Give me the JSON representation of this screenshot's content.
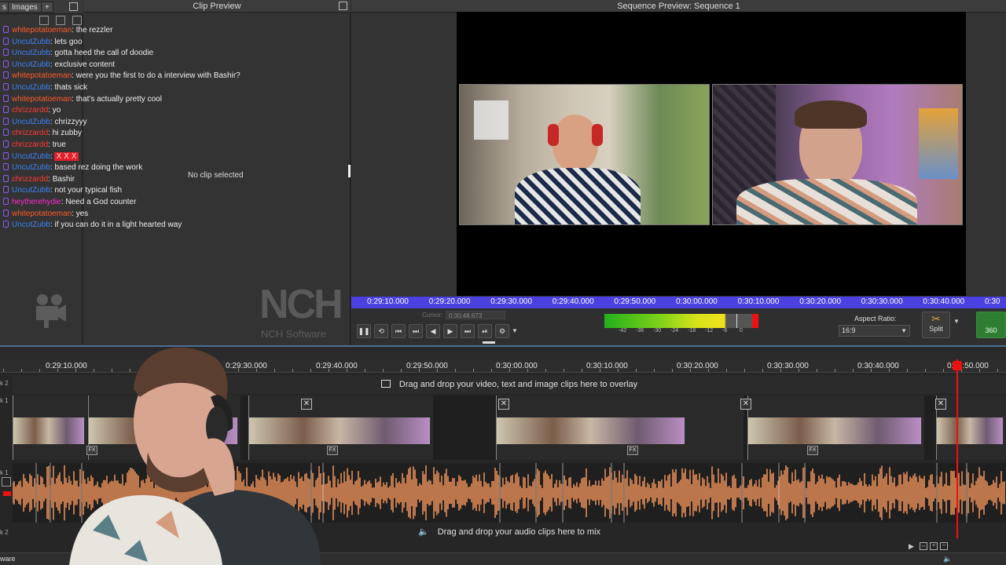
{
  "left_panel": {
    "tabs": [
      "s",
      "Images",
      "+"
    ],
    "clip_preview_title": "Clip Preview",
    "no_clip_text": "No clip selected",
    "logo_text": "NCH",
    "logo_sub": "NCH Software"
  },
  "chat": [
    {
      "user": "whitepotatoeman",
      "color": "orange",
      "msg": "the rezzler"
    },
    {
      "user": "UncutZubb",
      "color": "blue",
      "msg": "lets goo"
    },
    {
      "user": "UncutZubb",
      "color": "blue",
      "msg": "gotta heed the call of doodie"
    },
    {
      "user": "UncutZubb",
      "color": "blue",
      "msg": "exclusive content"
    },
    {
      "user": "whitepotatoeman",
      "color": "orange",
      "msg": "were you the first to do a interview with Bashir?"
    },
    {
      "user": "UncutZubb",
      "color": "blue",
      "msg": "thats sick"
    },
    {
      "user": "whitepotatoeman",
      "color": "orange",
      "msg": "that's actually pretty cool"
    },
    {
      "user": "chrizzardd",
      "color": "red",
      "msg": "yo"
    },
    {
      "user": "UncutZubb",
      "color": "blue",
      "msg": "chrizzyyy"
    },
    {
      "user": "chrizzardd",
      "color": "red",
      "msg": "hi zubby"
    },
    {
      "user": "chrizzardd",
      "color": "red",
      "msg": "true"
    },
    {
      "user": "UncutZubb",
      "color": "blue",
      "msg": "",
      "emote": "Ⅹ Ⅹ Ⅹ"
    },
    {
      "user": "UncutZubb",
      "color": "blue",
      "msg": "based rez doing the work"
    },
    {
      "user": "chrizzardd",
      "color": "red",
      "msg": "Bashir"
    },
    {
      "user": "UncutZubb",
      "color": "blue",
      "msg": "not your typical fish"
    },
    {
      "user": "heytherehydie",
      "color": "pink",
      "msg": "Need a God counter"
    },
    {
      "user": "whitepotatoeman",
      "color": "orange",
      "msg": "yes"
    },
    {
      "user": "UncutZubb",
      "color": "blue",
      "msg": "if you can do it in a light hearted way"
    }
  ],
  "sequence": {
    "title": "Sequence Preview: Sequence 1",
    "ruler_times": [
      "0:29:10.000",
      "0:29:20.000",
      "0:29:30.000",
      "0:29:40.000",
      "0:29:50.000",
      "0:30:00.000",
      "0:30:10.000",
      "0:30:20.000",
      "0:30:30.000",
      "0:30:40.000",
      "0:30"
    ],
    "cursor_label": "Cursor:",
    "cursor_time": "0:30:48.673",
    "meter_ticks": [
      "-42",
      "-36",
      "-30",
      "-24",
      "-18",
      "-12",
      "-6",
      "0"
    ],
    "aspect_label": "Aspect Ratio:",
    "aspect_value": "16:9",
    "split_label": "Split",
    "v360_label": "360"
  },
  "timeline": {
    "ruler_times": [
      "0:29:10.000",
      "0:29:30.000",
      "0:29:40.000",
      "0:29:50.000",
      "0:30:00.000",
      "0:30:10.000",
      "0:30:20.000",
      "0:30:30.000",
      "0:30:40.000",
      "0:30:50.000"
    ],
    "overlay_hint": "Drag and drop your video, text and image clips here to overlay",
    "audio_hint": "Drag and drop your audio clips here to mix",
    "status_text": "ware",
    "track_labels": [
      "k 2",
      "k 1",
      "k 1",
      "k 2"
    ]
  },
  "colors": {
    "ruler_blue": "#4b40e0",
    "audio_wave": "#f0935a",
    "playhead": "#ee1111",
    "v360_green": "#2e7d32"
  }
}
